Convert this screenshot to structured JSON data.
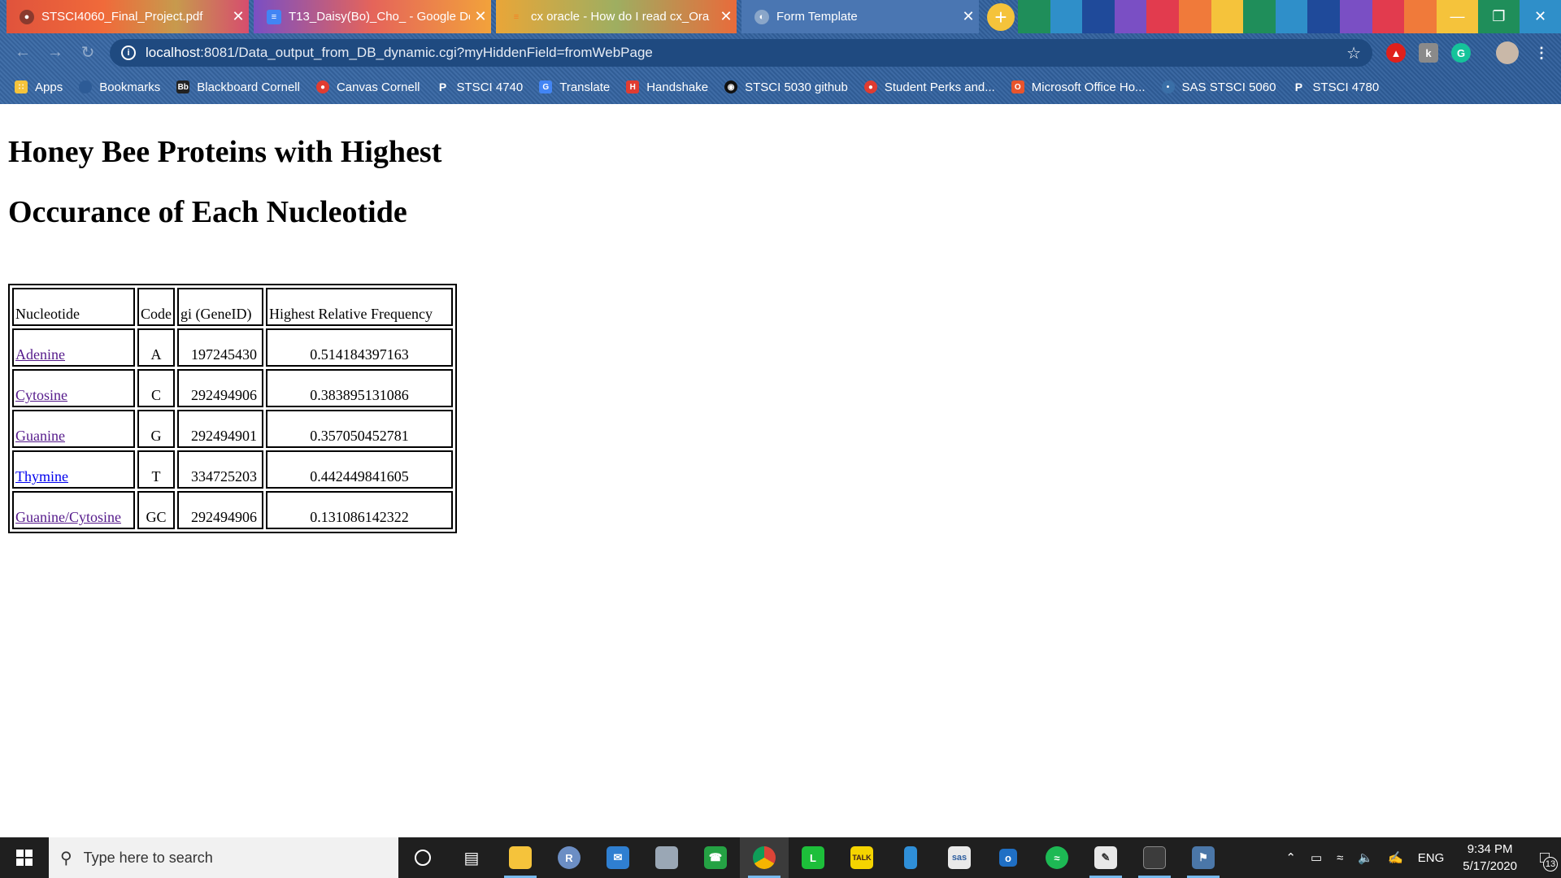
{
  "browser": {
    "tabs": [
      {
        "title": "STSCI4060_Final_Project.pdf",
        "close": "✕"
      },
      {
        "title": "T13_Daisy(Bo)_Cho_ - Google Do",
        "close": "✕"
      },
      {
        "title": "cx oracle - How do I read cx_Ora",
        "close": "✕"
      },
      {
        "title": "Form Template",
        "close": "✕"
      }
    ],
    "new_tab": "+",
    "url_host": "localhost",
    "url_path": ":8081/Data_output_from_DB_dynamic.cgi?myHiddenField=fromWebPage",
    "bookmarks": [
      {
        "label": "Apps",
        "icon": "apps-grid-icon",
        "color": "#f5c33b"
      },
      {
        "label": "Bookmarks",
        "icon": "folder-icon",
        "color": "#2d5b96"
      },
      {
        "label": "Blackboard Cornell",
        "icon": "blackboard-icon",
        "color": "#222222"
      },
      {
        "label": "Canvas Cornell",
        "icon": "canvas-icon",
        "color": "#e03c31"
      },
      {
        "label": "STSCI 4740",
        "icon": "piazza-icon",
        "color": "#3a6fa7"
      },
      {
        "label": "Translate",
        "icon": "translate-icon",
        "color": "#4285f4"
      },
      {
        "label": "Handshake",
        "icon": "handshake-icon",
        "color": "#e03c31"
      },
      {
        "label": "STSCI 5030 github",
        "icon": "github-icon",
        "color": "#111111"
      },
      {
        "label": "Student Perks and...",
        "icon": "perks-icon",
        "color": "#e03c31"
      },
      {
        "label": "Microsoft Office Ho...",
        "icon": "office-icon",
        "color": "#e8542c"
      },
      {
        "label": "SAS STSCI 5060",
        "icon": "sas-icon",
        "color": "#3a6fa7"
      },
      {
        "label": "STSCI 4780",
        "icon": "piazza-icon",
        "color": "#3a6fa7"
      }
    ]
  },
  "page": {
    "heading_line1": "Honey Bee Proteins with Highest",
    "heading_line2": "Occurance of Each Nucleotide",
    "table": {
      "headers": [
        "Nucleotide",
        "Code",
        "gi  (GeneID)",
        "Highest Relative Frequency"
      ],
      "rows": [
        {
          "nucleotide": "Adenine",
          "code": "A",
          "gi": "197245430",
          "freq": "0.514184397163"
        },
        {
          "nucleotide": "Cytosine",
          "code": "C",
          "gi": "292494906",
          "freq": "0.383895131086"
        },
        {
          "nucleotide": "Guanine",
          "code": "G",
          "gi": "292494901",
          "freq": "0.357050452781"
        },
        {
          "nucleotide": "Thymine",
          "code": "T",
          "gi": "334725203",
          "freq": "0.442449841605"
        },
        {
          "nucleotide": "Guanine/Cytosine",
          "code": "GC",
          "gi": "292494906",
          "freq": "0.131086142322"
        }
      ]
    }
  },
  "taskbar": {
    "search_placeholder": "Type here to search",
    "language": "ENG",
    "time": "9:34 PM",
    "date": "5/17/2020",
    "notification_count": "13"
  },
  "colors": {
    "chrome_bg": "#2d5b96",
    "visited_link": "#551a8b",
    "unvisited_link": "#0000ee",
    "taskbar_bg": "#1f1f1f"
  }
}
